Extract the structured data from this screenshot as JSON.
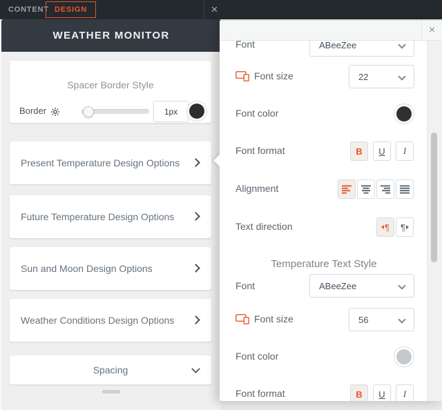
{
  "topbar": {
    "tab_content": "CONTENT",
    "tab_design": "DESIGN",
    "close": "×"
  },
  "left_panel": {
    "title": "WEATHER MONITOR",
    "spacer_card": {
      "title": "Spacer Border Style",
      "border_label": "Border",
      "border_value": "1px",
      "swatch_color": "#2e2e30"
    },
    "cards": [
      "Present Temperature Design Options",
      "Future Temperature Design Options",
      "Sun and Moon Design Options",
      "Weather Conditions Design Options"
    ],
    "spacing_label": "Spacing"
  },
  "right_panel": {
    "close": "×",
    "text_style": {
      "font_label": "Font",
      "font_value": "ABeeZee",
      "font_size_label": "Font size",
      "font_size_value": "22",
      "font_color_label": "Font color",
      "font_color": "#2e3133",
      "font_format_label": "Font format",
      "alignment_label": "Alignment",
      "text_direction_label": "Text direction"
    },
    "temperature_text_style": {
      "title": "Temperature Text Style",
      "font_label": "Font",
      "font_value": "ABeeZee",
      "font_size_label": "Font size",
      "font_size_value": "56",
      "font_color_label": "Font color",
      "font_color": "#c6c9cb",
      "font_format_label": "Font format"
    },
    "format": {
      "bold": "B",
      "underline": "U",
      "italic": "I"
    },
    "icons": {
      "pilcrow": "¶",
      "font_size": "responsive-devices-icon",
      "gear": "gear-icon"
    }
  },
  "colors": {
    "accent": "#e8552f",
    "topbar_bg": "#24292e",
    "header_bg": "#343a41",
    "panel_bg": "#efefef"
  }
}
